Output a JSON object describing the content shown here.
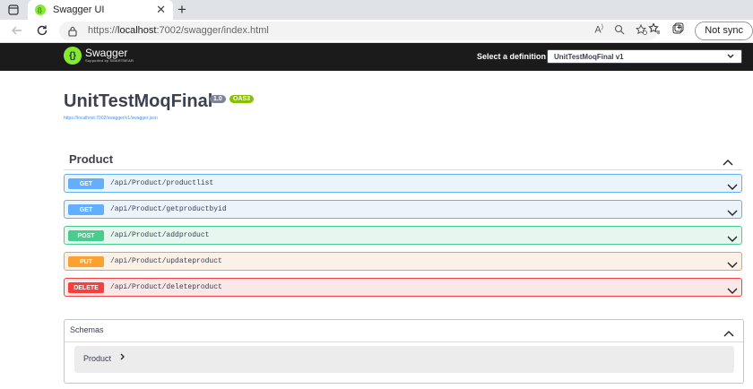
{
  "browser": {
    "tab_title": "Swagger UI",
    "url_prefix": "https://",
    "url_host": "localhost",
    "url_rest": ":7002/swagger/index.html",
    "profile_label": "Not sync"
  },
  "topbar": {
    "logo_text": "Swagger",
    "logo_sub": "Supported by SMARTBEAR",
    "select_label": "Select a definition",
    "select_value": "UnitTestMoqFinal v1"
  },
  "info": {
    "title": "UnitTestMoqFinal",
    "version": "1.0",
    "oas": "OAS3",
    "spec_link": "https://localhost:7002/swagger/v1/swagger.json"
  },
  "section": {
    "name": "Product",
    "operations": [
      {
        "method": "GET",
        "path": "/api/Product/productlist"
      },
      {
        "method": "GET",
        "path": "/api/Product/getproductbyid"
      },
      {
        "method": "POST",
        "path": "/api/Product/addproduct"
      },
      {
        "method": "PUT",
        "path": "/api/Product/updateproduct"
      },
      {
        "method": "DELETE",
        "path": "/api/Product/deleteproduct"
      }
    ]
  },
  "schemas": {
    "title": "Schemas",
    "models": [
      {
        "name": "Product"
      }
    ]
  },
  "colors": {
    "get": "#61affe",
    "post": "#49cc90",
    "put": "#fca130",
    "delete": "#f93e3e",
    "topbar": "#1b1b1b",
    "swagger_green": "#85ea2d"
  }
}
